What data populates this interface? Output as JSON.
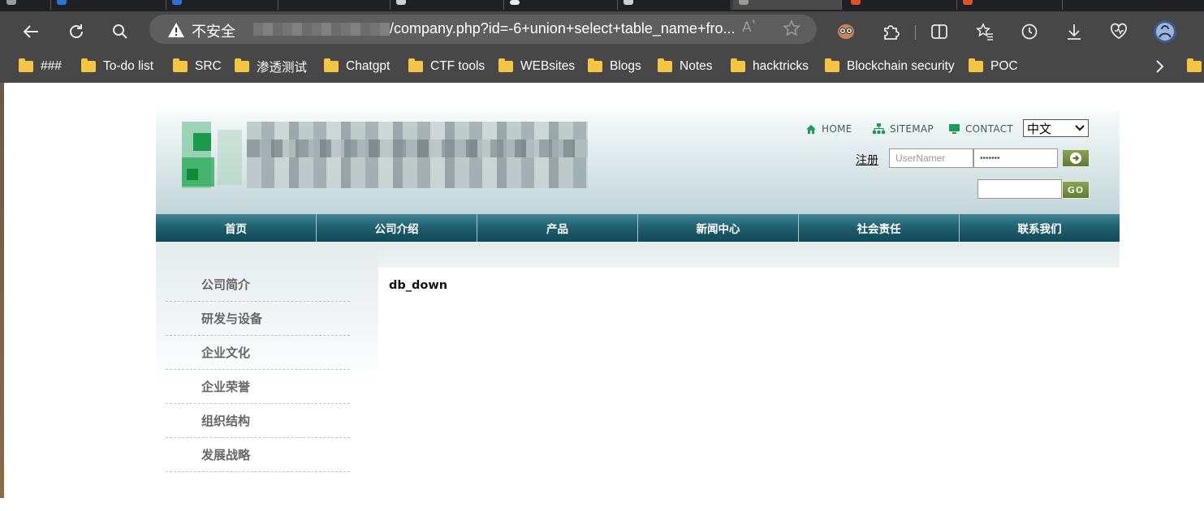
{
  "browser": {
    "url_security_label": "不安全",
    "url_path": "/company.php?id=-6+union+select+table_name+fro...",
    "read_aloud_label": "Aʽ",
    "bookmarks": [
      "###",
      "To-do list",
      "SRC",
      "渗透测试",
      "Chatgpt",
      "CTF tools",
      "WEBsites",
      "Blogs",
      "Notes",
      "hacktricks",
      "Blockchain security",
      "POC"
    ],
    "icons": [
      "back-icon",
      "refresh-icon",
      "search-icon",
      "warning-icon",
      "favorite-star-icon",
      "extension-badge-icon",
      "extensions-icon",
      "split-screen-icon",
      "favorites-icon",
      "history-icon",
      "downloads-icon",
      "browser-essentials-icon",
      "profile-avatar-icon",
      "chevron-right-icon"
    ],
    "colors": {
      "chrome": "#474747",
      "tabstrip": "#202124",
      "folder": "#f4c542"
    }
  },
  "site": {
    "top_links": {
      "home": "HOME",
      "sitemap": "SITEMAP",
      "contact": "CONTACT"
    },
    "language": "中文",
    "register_label": "注册",
    "username_placeholder": "UserNamer",
    "password_mask": "•••••••",
    "go_label": "GO",
    "nav": [
      "首页",
      "公司介绍",
      "产品",
      "新闻中心",
      "社会责任",
      "联系我们"
    ],
    "sidebar": [
      "公司简介",
      "研发与设备",
      "企业文化",
      "企业荣誉",
      "组织结构",
      "发展战略"
    ],
    "content_text": "db_down",
    "colors": {
      "nav": "#1e5e6c",
      "button": "#6f8a44",
      "header_top": "#f7fbfb"
    }
  }
}
